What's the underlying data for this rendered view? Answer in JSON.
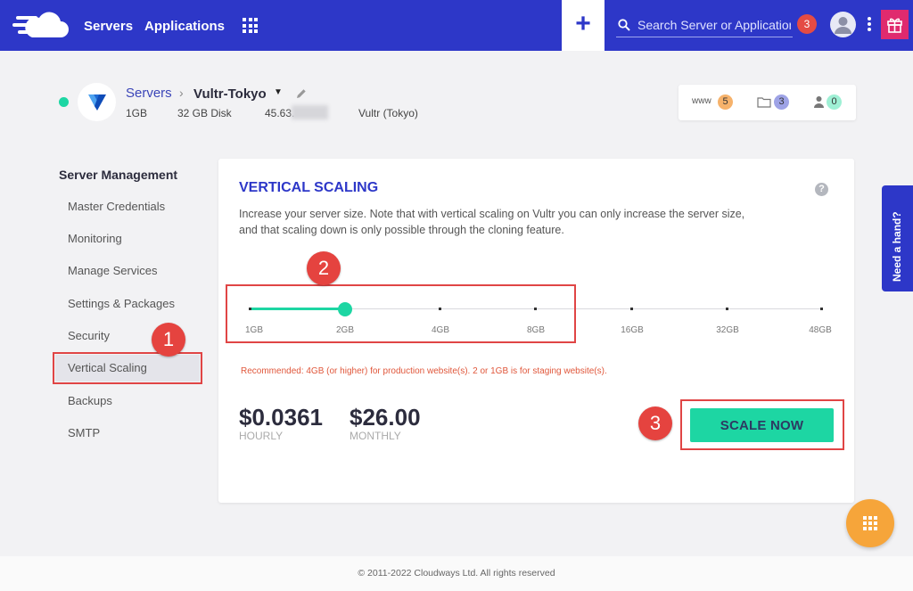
{
  "topbar": {
    "nav": {
      "servers": "Servers",
      "applications": "Applications"
    },
    "plus_label": "+",
    "search": {
      "placeholder": "Search Server or Application"
    },
    "notifications_count": "3"
  },
  "server": {
    "breadcrumb_root": "Servers",
    "separator": "›",
    "name": "Vultr-Tokyo",
    "caret": "▼",
    "ram": "1GB",
    "disk": "32 GB Disk",
    "ip_partial": "45.63.",
    "provider": "Vultr (Tokyo)",
    "stats": {
      "www_label": "www",
      "www_count": "5",
      "folder_count": "3",
      "users_count": "0"
    }
  },
  "sidebar": {
    "title": "Server Management",
    "items": [
      {
        "label": "Master Credentials"
      },
      {
        "label": "Monitoring"
      },
      {
        "label": "Manage Services"
      },
      {
        "label": "Settings & Packages"
      },
      {
        "label": "Security"
      },
      {
        "label": "Vertical Scaling"
      },
      {
        "label": "Backups"
      },
      {
        "label": "SMTP"
      }
    ]
  },
  "scaling": {
    "title": "VERTICAL SCALING",
    "help": "?",
    "description": "Increase your server size. Note that with vertical scaling on Vultr you can only increase the server size, and that scaling down is only possible through the cloning feature.",
    "sizes": [
      "1GB",
      "2GB",
      "4GB",
      "8GB",
      "16GB",
      "32GB",
      "48GB"
    ],
    "selected_size": "2GB",
    "recommendation": "Recommended: 4GB (or higher) for production website(s). 2 or 1GB is for staging website(s).",
    "hourly_price": "$0.0361",
    "hourly_label": "HOURLY",
    "monthly_price": "$26.00",
    "monthly_label": "MONTHLY",
    "scale_button": "SCALE NOW"
  },
  "callouts": [
    "1",
    "2",
    "3"
  ],
  "help_tab": "Need a hand?",
  "footer": "© 2011-2022 Cloudways Ltd. All rights reserved",
  "colors": {
    "primary": "#2d37c8",
    "accent": "#1dd6a3",
    "callout": "#e5433f",
    "warning_text": "#e0573b",
    "fab": "#f6a53a"
  }
}
